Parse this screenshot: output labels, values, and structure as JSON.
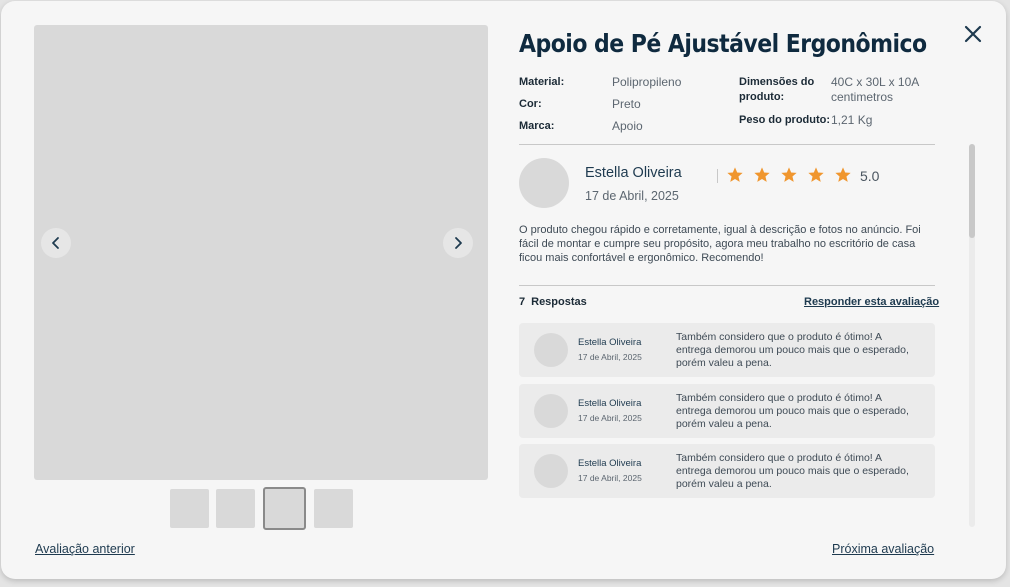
{
  "product": {
    "title": "Apoio de Pé Ajustável Ergonômico",
    "specs_left": [
      {
        "label": "Material:",
        "value": "Polipropileno"
      },
      {
        "label": "Cor:",
        "value": "Preto"
      },
      {
        "label": "Marca:",
        "value": "Apoio"
      }
    ],
    "specs_right": [
      {
        "label_line1": "Dimensões do",
        "label_line2": "produto:",
        "value_line1": "40C x 30L x 10A",
        "value_line2": "centimetros"
      },
      {
        "label": "Peso do produto:",
        "value": "1,21 Kg"
      }
    ]
  },
  "review": {
    "name": "Estella Oliveira",
    "date": "17 de Abril, 2025",
    "rating": "5.0",
    "stars": 5,
    "text": "O produto chegou rápido e corretamente, igual à descrição e fotos no anúncio. Foi fácil de montar e cumpre seu propósito, agora meu trabalho no escritório de casa ficou mais confortável e ergonômico. Recomendo!"
  },
  "responses": {
    "count": "7",
    "label": "Respostas",
    "reply_link": "Responder esta avaliação",
    "items": [
      {
        "name": "Estella Oliveira",
        "date": "17 de Abril, 2025",
        "text": "Também considero que o produto é ótimo! A entrega demorou um pouco mais que o esperado, porém valeu a pena."
      },
      {
        "name": "Estella Oliveira",
        "date": "17 de Abril, 2025",
        "text": "Também considero que o produto é ótimo! A entrega demorou um pouco mais que o esperado, porém valeu a pena."
      },
      {
        "name": "Estella Oliveira",
        "date": "17 de Abril, 2025",
        "text": "Também considero que o produto é ótimo! A entrega demorou um pouco mais que o esperado, porém valeu a pena."
      }
    ]
  },
  "footer": {
    "prev_link": "Avaliação anterior",
    "next_link": "Próxima avaliação"
  },
  "icons": {
    "close": "close-icon",
    "prev": "chevron-left-icon",
    "next": "chevron-right-icon",
    "star": "star-icon"
  },
  "colors": {
    "title": "#0f2a3f",
    "star": "#f0962e",
    "image_placeholder": "#d9d9d9",
    "card_bg": "#ebebeb"
  },
  "gallery": {
    "thumbnail_count": 4,
    "active_thumbnail": 3
  }
}
